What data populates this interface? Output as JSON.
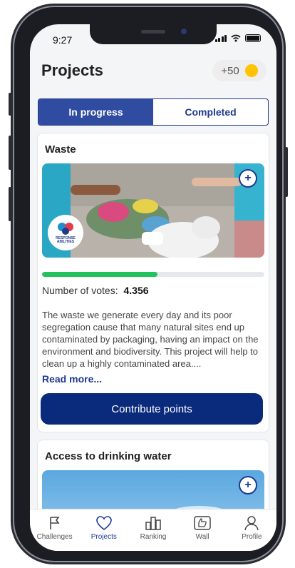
{
  "status_bar": {
    "time": "9:27"
  },
  "header": {
    "title": "Projects",
    "points": "+50"
  },
  "tabs": [
    {
      "label": "In progress",
      "active": true
    },
    {
      "label": "Completed",
      "active": false
    }
  ],
  "projects": [
    {
      "title": "Waste",
      "logo_text": "RESPONSE ABILITIES",
      "progress_fraction": 0.52,
      "votes_label": "Number of votes:",
      "votes_value": "4.356",
      "description": "The waste we generate every day and its poor segregation cause that many natural sites end up contaminated by packaging, having an impact on the environment and biodiversity. This project will help to clean up a highly contaminated area....",
      "read_more": "Read more...",
      "cta": "Contribute points"
    },
    {
      "title": "Access to drinking water"
    }
  ],
  "tabbar": [
    {
      "label": "Challenges",
      "icon": "flag-icon"
    },
    {
      "label": "Projects",
      "icon": "heart-icon",
      "active": true
    },
    {
      "label": "Ranking",
      "icon": "bar-chart-icon"
    },
    {
      "label": "Wall",
      "icon": "thumbs-up-icon"
    },
    {
      "label": "Profile",
      "icon": "user-icon"
    }
  ],
  "colors": {
    "primary": "#0a2a7c",
    "tab_active": "#2f4ca0",
    "progress": "#21c35e",
    "coin": "#ffc300"
  }
}
